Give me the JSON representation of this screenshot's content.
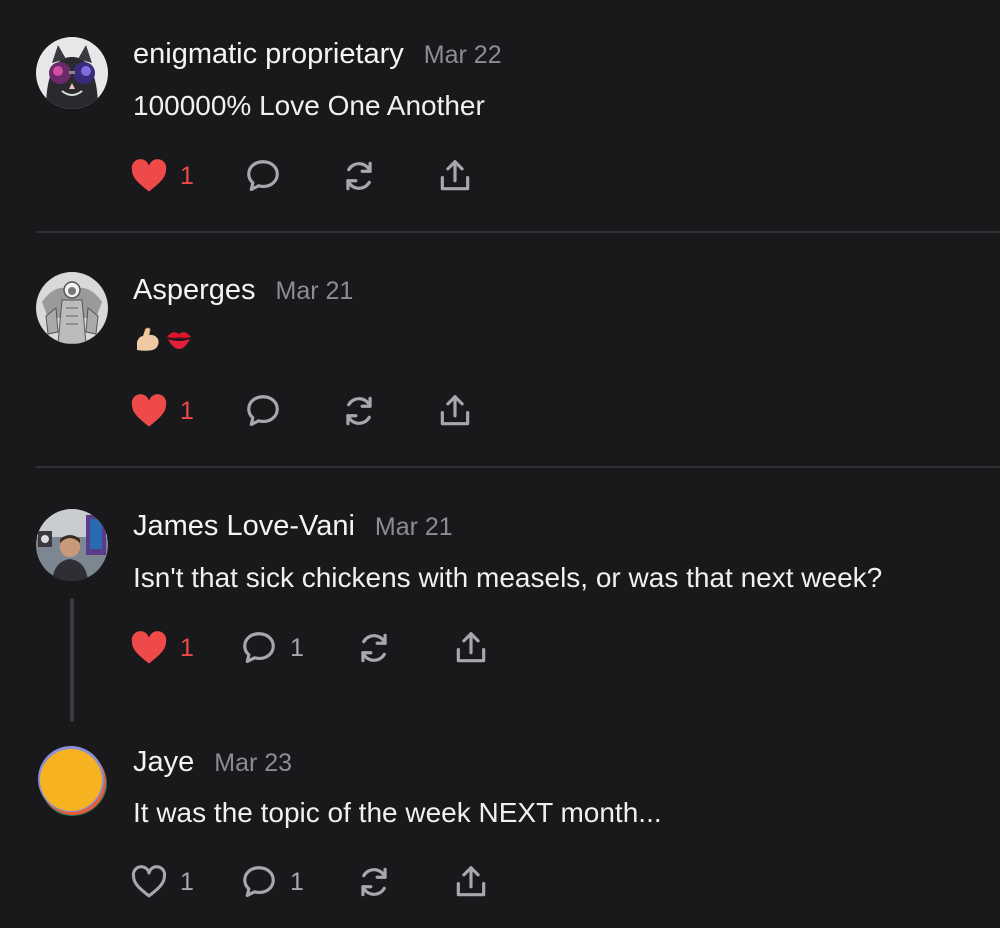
{
  "comments": [
    {
      "author": "enigmatic proprietary",
      "date": "Mar 22",
      "text": "100000% Love One Another",
      "likes": "1",
      "liked": true,
      "replies": ""
    },
    {
      "author": "Asperges",
      "date": "Mar 21",
      "text": "💪🏻💋",
      "likes": "1",
      "liked": true,
      "replies": ""
    },
    {
      "author": "James Love-Vani",
      "date": "Mar 21",
      "text": "Isn't that sick chickens with measels, or was that next week?",
      "likes": "1",
      "liked": true,
      "replies": "1"
    },
    {
      "author": "Jaye",
      "date": "Mar 23",
      "text": "It was the topic of the week NEXT month...",
      "likes": "1",
      "liked": false,
      "replies": "1"
    }
  ],
  "icons": {
    "like": "heart-icon",
    "reply": "speech-bubble-icon",
    "restack": "restack-icon",
    "share": "share-icon"
  },
  "colors": {
    "background": "#19181b",
    "liked": "#ef4a4a",
    "muted": "#a9a7ad",
    "divider": "#313034"
  }
}
